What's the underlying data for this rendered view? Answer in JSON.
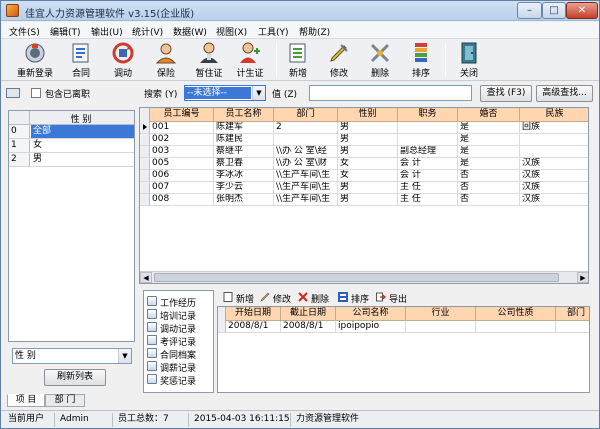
{
  "window": {
    "title": "佳宜人力资源管理软件 v3.15(企业版)",
    "min": "–",
    "max": "□",
    "close": "✕"
  },
  "menu": [
    "文件(S)",
    "编辑(T)",
    "输出(U)",
    "统计(V)",
    "数据(W)",
    "视图(X)",
    "工具(Y)",
    "帮助(Z)"
  ],
  "toolbar": [
    {
      "label": "重新登录",
      "icon": "relogin-icon"
    },
    {
      "label": "合同",
      "icon": "contract-icon"
    },
    {
      "label": "调动",
      "icon": "transfer-icon"
    },
    {
      "label": "保险",
      "icon": "insurance-icon"
    },
    {
      "label": "暂住证",
      "icon": "residence-permit-icon"
    },
    {
      "label": "计生证",
      "icon": "family-planning-icon"
    },
    {
      "label": "新增",
      "icon": "add-icon"
    },
    {
      "label": "修改",
      "icon": "edit-icon"
    },
    {
      "label": "删除",
      "icon": "delete-icon"
    },
    {
      "label": "排序",
      "icon": "sort-icon"
    },
    {
      "label": "关闭",
      "icon": "close-door-icon"
    }
  ],
  "search": {
    "include_left": "包含已离职",
    "search_label": "搜索 (Y)",
    "field_value": "--未选择--",
    "value_label": "值 (Z)",
    "value_input": "",
    "find_button": "查找 (F3)",
    "advanced_button": "高级查找..."
  },
  "left_panel": {
    "header": "性 别",
    "rows": [
      {
        "index": "0",
        "label": "全部",
        "selected": true
      },
      {
        "index": "1",
        "label": "女",
        "selected": false
      },
      {
        "index": "2",
        "label": "男",
        "selected": false
      }
    ],
    "group_by": "性 别",
    "refresh_button": "刷新列表",
    "tabs": [
      "项 目",
      "部 门"
    ]
  },
  "grid": {
    "columns": [
      "员工编号",
      "员工名称",
      "部门",
      "性别",
      "职务",
      "婚否",
      "民族"
    ],
    "rows": [
      [
        "001",
        "陈建军",
        "2",
        "男",
        "",
        "是",
        "回族"
      ],
      [
        "002",
        "陈建民",
        "",
        "男",
        "",
        "是",
        ""
      ],
      [
        "003",
        "蔡继平",
        "\\\\办 公 室\\经",
        "男",
        "副总经理",
        "是",
        ""
      ],
      [
        "005",
        "蔡卫春",
        "\\\\办 公 室\\财",
        "女",
        "会 计",
        "是",
        "汉族"
      ],
      [
        "006",
        "李冰冰",
        "\\\\生产车间\\生",
        "女",
        "会 计",
        "否",
        "汉族"
      ],
      [
        "007",
        "李少云",
        "\\\\生产车间\\生",
        "男",
        "主 任",
        "否",
        "汉族"
      ],
      [
        "008",
        "张明杰",
        "\\\\生产车间\\生",
        "男",
        "主 任",
        "否",
        "汉族"
      ]
    ]
  },
  "record_nav": [
    "工作经历",
    "培训记录",
    "调动记录",
    "考评记录",
    "合同档案",
    "调薪记录",
    "奖惩记录"
  ],
  "sub_toolbar": [
    "新增",
    "修改",
    "删除",
    "排序",
    "导出"
  ],
  "sub_grid": {
    "columns": [
      "开始日期",
      "截止日期",
      "公司名称",
      "行业",
      "公司性质",
      "部门"
    ],
    "rows": [
      [
        "2008/8/1",
        "2008/8/1",
        "ipoipopio",
        "",
        "",
        ""
      ]
    ]
  },
  "status": {
    "user_label": "当前用户",
    "user": "Admin",
    "total": "员工总数：7",
    "datetime": "2015-04-03 16:11:15",
    "app": "力资源管理软件"
  },
  "colors": {
    "grid_header": "#ffd6b0",
    "selection": "#3b78d8"
  }
}
